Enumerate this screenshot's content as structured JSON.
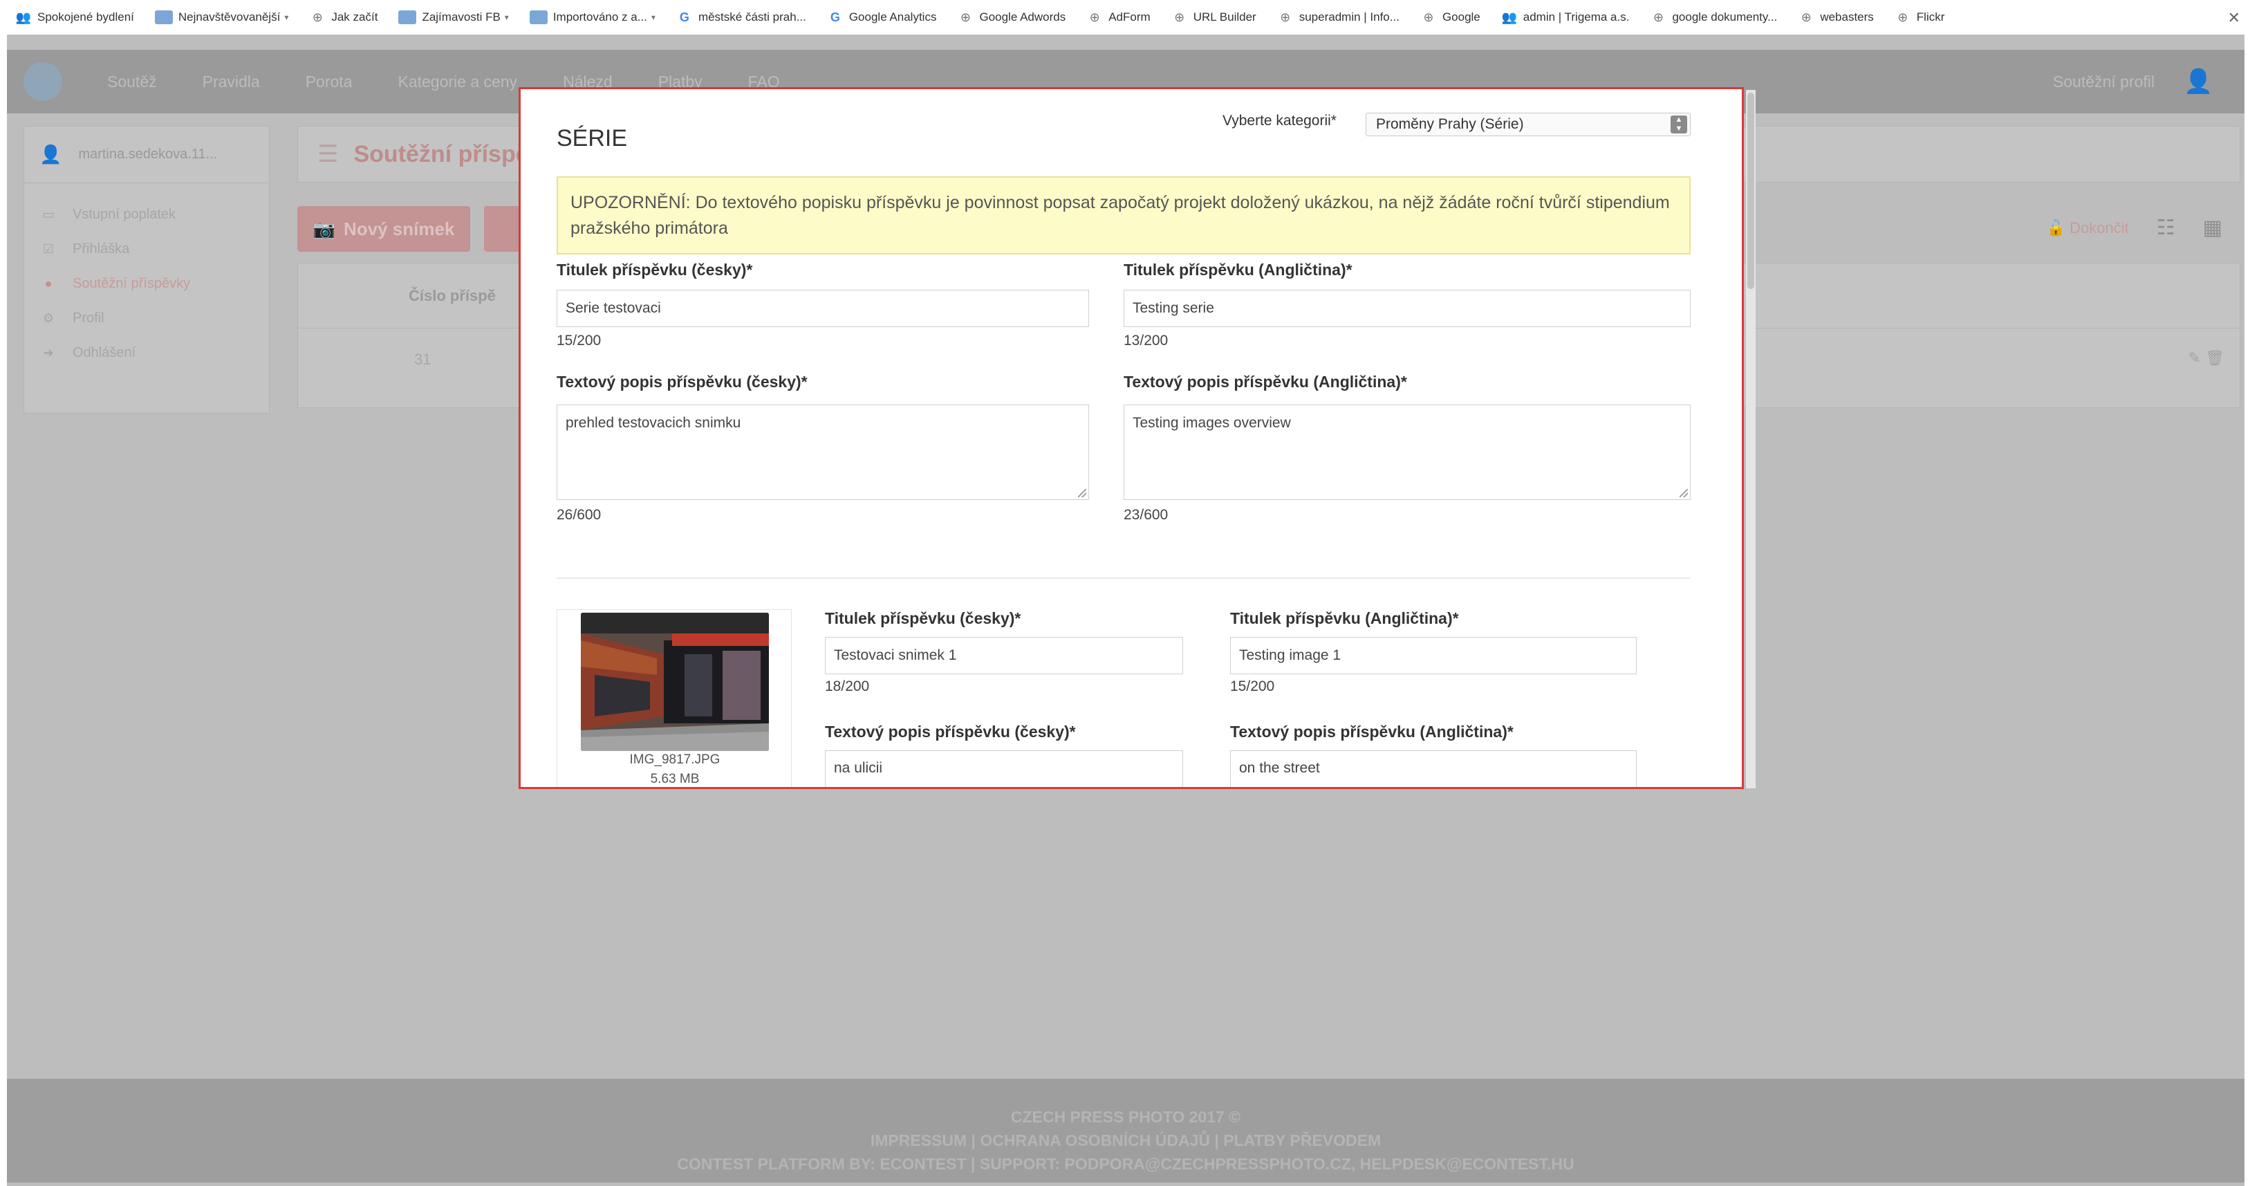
{
  "bookmarks": [
    {
      "label": "Spokojené bydlení",
      "icon": "people-icon",
      "caret": false
    },
    {
      "label": "Nejnavštěvovanější",
      "icon": "folder-icon",
      "caret": true
    },
    {
      "label": "Jak začít",
      "icon": "globe-icon",
      "caret": false
    },
    {
      "label": "Zajímavosti FB",
      "icon": "folder-icon",
      "caret": true
    },
    {
      "label": "Importováno z a...",
      "icon": "folder-icon",
      "caret": true
    },
    {
      "label": "městské části prah...",
      "icon": "google-icon",
      "caret": false
    },
    {
      "label": "Google Analytics",
      "icon": "google-icon",
      "caret": false
    },
    {
      "label": "Google Adwords",
      "icon": "globe-icon",
      "caret": false
    },
    {
      "label": "AdForm",
      "icon": "globe-icon",
      "caret": false
    },
    {
      "label": "URL Builder",
      "icon": "globe-icon",
      "caret": false
    },
    {
      "label": "superadmin | Info...",
      "icon": "globe-icon",
      "caret": false
    },
    {
      "label": "Google",
      "icon": "globe-icon",
      "caret": false
    },
    {
      "label": "admin | Trigema a.s.",
      "icon": "people-icon",
      "caret": false
    },
    {
      "label": "google dokumenty...",
      "icon": "globe-icon",
      "caret": false
    },
    {
      "label": "webasters",
      "icon": "globe-icon",
      "caret": false
    },
    {
      "label": "Flickr",
      "icon": "globe-icon",
      "caret": false
    }
  ],
  "nav": {
    "items": [
      "Soutěž",
      "Pravidla",
      "Porota",
      "Kategorie a ceny",
      "Nálezd",
      "Platby",
      "FAQ"
    ],
    "profile": "Soutěžní profil"
  },
  "sidebar": {
    "user": "martina.sedekova.11...",
    "items": [
      {
        "label": "Vstupní poplatek",
        "icon": "money-icon",
        "active": false
      },
      {
        "label": "Přihláška",
        "icon": "form-icon",
        "active": false
      },
      {
        "label": "Soutěžní příspěvky",
        "icon": "camera-icon",
        "active": true
      },
      {
        "label": "Profil",
        "icon": "gear-icon",
        "active": false
      },
      {
        "label": "Odhlášení",
        "icon": "logout-icon",
        "active": false
      }
    ]
  },
  "content": {
    "heading": "Soutěžní příspě",
    "new_button": "Nový snímek",
    "finish": "Dokončit",
    "column": "Číslo příspě",
    "row_number": "31"
  },
  "modal": {
    "title": "SÉRIE",
    "category_label": "Vyberte kategorii*",
    "category_value": "Proměny Prahy (Série)",
    "alert": "UPOZORNĚNÍ: Do textového popisku příspěvku je povinnost popsat započatý projekt doložený ukázkou, na nějž žádáte roční tvůrčí stipendium pražského primátora",
    "title_cz_label": "Titulek příspěvku (česky)*",
    "title_cz_value": "Serie testovaci",
    "title_cz_count": "15/200",
    "title_en_label": "Titulek příspěvku (Angličtina)*",
    "title_en_value": "Testing serie",
    "title_en_count": "13/200",
    "desc_cz_label": "Textový popis příspěvku (česky)*",
    "desc_cz_value": "prehled testovacich snimku",
    "desc_cz_count": "26/600",
    "desc_en_label": "Textový popis příspěvku (Angličtina)*",
    "desc_en_value": "Testing images overview",
    "desc_en_count": "23/600",
    "image": {
      "filename": "IMG_9817.JPG",
      "size": "5.63 MB",
      "title_cz_label": "Titulek příspěvku (česky)*",
      "title_cz_value": "Testovaci snimek 1",
      "title_cz_count": "18/200",
      "title_en_label": "Titulek příspěvku (Angličtina)*",
      "title_en_value": "Testing image 1",
      "title_en_count": "15/200",
      "desc_cz_label": "Textový popis příspěvku (česky)*",
      "desc_cz_value": "na ulicii",
      "desc_en_label": "Textový popis příspěvku (Angličtina)*",
      "desc_en_value": "on the street"
    }
  },
  "footer": {
    "line1": "CZECH PRESS PHOTO 2017 ©",
    "line2": "IMPRESSUM | OCHRANA OSOBNÍCH ÚDAJŮ | PLATBY PŘEVODEM",
    "line3": "CONTEST PLATFORM BY: ECONTEST | SUPPORT: PODPORA@CZECHPRESSPHOTO.CZ, HELPDESK@ECONTEST.HU"
  },
  "colors": {
    "modal_border": "#d93a3a",
    "alert_bg": "#fdfcc8",
    "accent": "#c49393"
  }
}
